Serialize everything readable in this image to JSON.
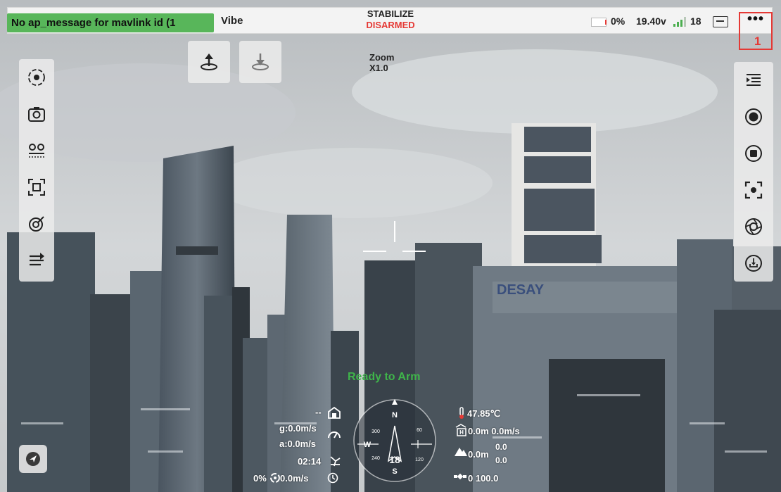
{
  "topbar": {
    "ap_message": "No ap_message for mavlink id (1",
    "vehicle_type": "Vibe",
    "flight_mode": "STABILIZE",
    "arm_state": "DISARMED",
    "battery_pct": "0%",
    "voltage": "19.40v",
    "sat_count": "18",
    "more_label": "•••",
    "annotation_number": "1"
  },
  "zoom": {
    "label": "Zoom",
    "value": "X1.0"
  },
  "status": {
    "ready": "Ready to Arm"
  },
  "telemetry": {
    "dash_top": "--",
    "ground_speed": "g:0.0m/s",
    "air_speed": "a:0.0m/s",
    "flight_time": "02:14",
    "throttle": "0%",
    "climb": "0.0m/s",
    "temperature": "47.85℃",
    "height_line": "0.0m 0.0m/s",
    "alt_val": "0.0m",
    "alt_stack_top": "0.0",
    "alt_stack_bottom": "0.0",
    "gps_line": "0 100.0"
  },
  "compass": {
    "heading": "18",
    "north": "N",
    "south": "S",
    "west": "W",
    "ticks": [
      "300",
      "60",
      "240",
      "120"
    ]
  },
  "colors": {
    "accent_green": "#58b65a",
    "disarmed_red": "#e53935",
    "ready_green": "#3fb44a"
  },
  "icons": {
    "left_toolbar": [
      "gimbal-center-icon",
      "camera-switch-icon",
      "waypoints-icon",
      "frame-select-icon",
      "satellite-dish-icon",
      "flight-path-icon"
    ],
    "right_toolbar": [
      "collapse-menu-icon",
      "record-icon",
      "stop-record-icon",
      "focus-icon",
      "aperture-icon",
      "download-icon"
    ]
  }
}
